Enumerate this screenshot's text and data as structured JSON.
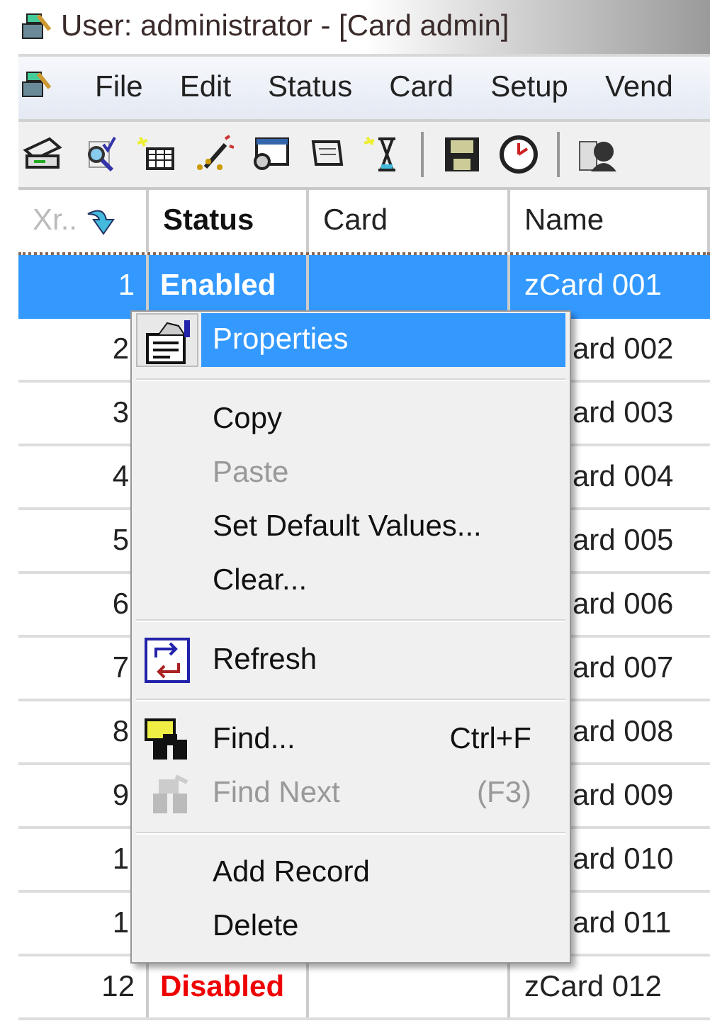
{
  "window": {
    "title": "User: administrator - [Card admin]"
  },
  "menu_bar": [
    "File",
    "Edit",
    "Status",
    "Card",
    "Setup",
    "Vend"
  ],
  "table": {
    "columns": [
      "Xr..",
      "Status",
      "Card",
      "Name"
    ],
    "rows": [
      {
        "number": "1",
        "status": "Enabled",
        "disabled": false,
        "name": "zCard 001",
        "selected": true
      },
      {
        "number": "2",
        "name": "ard 002",
        "selected": false
      },
      {
        "number": "3",
        "name": "ard 003",
        "selected": false
      },
      {
        "number": "4",
        "name": "ard 004",
        "selected": false
      },
      {
        "number": "5",
        "name": "ard 005",
        "selected": false
      },
      {
        "number": "6",
        "name": "ard 006",
        "selected": false
      },
      {
        "number": "7",
        "name": "ard 007",
        "selected": false
      },
      {
        "number": "8",
        "name": "ard 008",
        "selected": false
      },
      {
        "number": "9",
        "name": "ard 009",
        "selected": false
      },
      {
        "number": "1",
        "name": "ard 010",
        "selected": false
      },
      {
        "number": "1",
        "name": "ard 011",
        "selected": false
      },
      {
        "number": "12",
        "status": "Disabled",
        "disabled": true,
        "name": "zCard 012",
        "selected": false
      }
    ]
  },
  "context_menu": [
    {
      "kind": "item",
      "label": "Properties",
      "selected": true,
      "disabled": false
    },
    {
      "kind": "separator"
    },
    {
      "kind": "item",
      "label": "Copy",
      "selected": false,
      "disabled": false
    },
    {
      "kind": "item",
      "label": "Paste",
      "selected": false,
      "disabled": true
    },
    {
      "kind": "item",
      "label": "Set Default Values...",
      "selected": false,
      "disabled": false
    },
    {
      "kind": "item",
      "label": "Clear...",
      "selected": false,
      "disabled": false
    },
    {
      "kind": "separator"
    },
    {
      "kind": "item",
      "label": "Refresh",
      "selected": false,
      "disabled": false
    },
    {
      "kind": "separator"
    },
    {
      "kind": "item",
      "label": "Find...",
      "shortcut": "Ctrl+F",
      "selected": false,
      "disabled": false
    },
    {
      "kind": "item",
      "label": "Find Next",
      "shortcut": "(F3)",
      "selected": false,
      "disabled": true
    },
    {
      "kind": "separator"
    },
    {
      "kind": "item",
      "label": "Add Record",
      "selected": false,
      "disabled": false
    },
    {
      "kind": "item",
      "label": "Delete",
      "selected": false,
      "disabled": false
    }
  ]
}
